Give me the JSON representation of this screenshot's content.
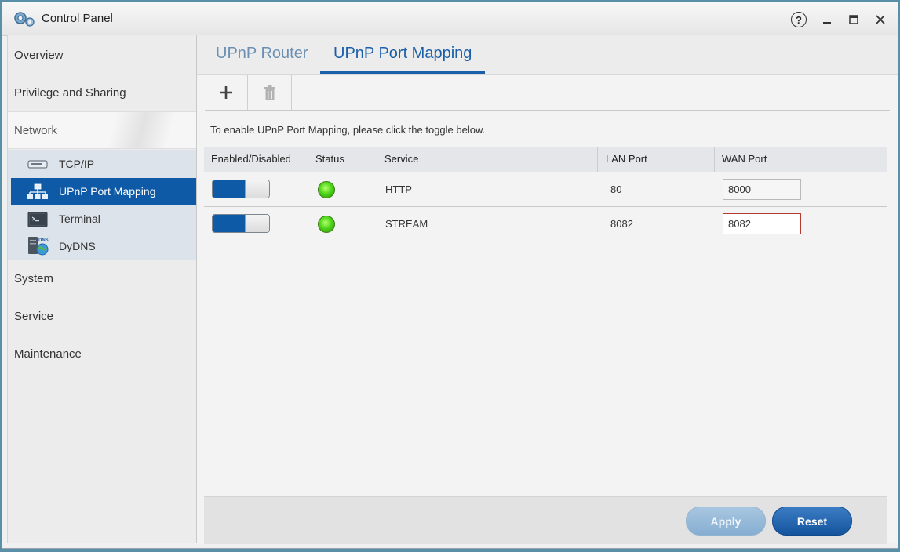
{
  "window": {
    "title": "Control Panel",
    "help_glyph": "?",
    "controls": [
      "help-icon",
      "minimize-icon",
      "maximize-icon",
      "close-icon"
    ]
  },
  "sidebar": {
    "items": [
      {
        "label": "Overview"
      },
      {
        "label": "Privilege and Sharing"
      },
      {
        "label": "Network"
      },
      {
        "label": "System"
      },
      {
        "label": "Service"
      },
      {
        "label": "Maintenance"
      }
    ],
    "network_children": [
      {
        "label": "TCP/IP",
        "icon": "network-card-icon"
      },
      {
        "label": "UPnP Port Mapping",
        "icon": "network-tree-icon",
        "active": true
      },
      {
        "label": "Terminal",
        "icon": "terminal-icon"
      },
      {
        "label": "DyDNS",
        "icon": "dns-globe-icon",
        "icon_text": "DNS"
      }
    ]
  },
  "tabs": [
    {
      "label": "UPnP Router",
      "active": false
    },
    {
      "label": "UPnP Port Mapping",
      "active": true
    }
  ],
  "toolbar": {
    "add_icon": "plus-icon",
    "delete_icon": "trash-icon"
  },
  "hint": "To enable UPnP Port Mapping, please click the toggle below.",
  "table": {
    "headers": [
      "Enabled/Disabled",
      "Status",
      "Service",
      "LAN Port",
      "WAN Port"
    ],
    "rows": [
      {
        "enabled": true,
        "status": "green",
        "service": "HTTP",
        "lan_port": "80",
        "wan_port": "8000",
        "wan_error": false
      },
      {
        "enabled": true,
        "status": "green",
        "service": "STREAM",
        "lan_port": "8082",
        "wan_port": "8082",
        "wan_error": true
      }
    ]
  },
  "buttons": {
    "apply": "Apply",
    "reset": "Reset"
  },
  "colors": {
    "accent": "#0e5aa7",
    "status_ok": "#4fd61b",
    "error_border": "#b53a30"
  }
}
